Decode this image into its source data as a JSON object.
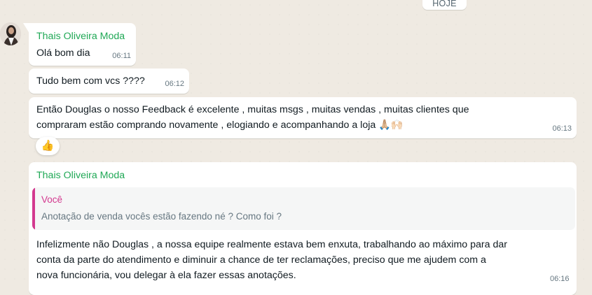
{
  "date_chip": "HOJE",
  "messages": [
    {
      "sender": "Thais Oliveira Moda",
      "text": "Olá bom dia",
      "time": "06:11"
    },
    {
      "text": "Tudo bem com vcs ????",
      "time": "06:12"
    },
    {
      "text_line1": "Então Douglas o nosso Feedback é excelente , muitas msgs , muitas vendas , muitas clientes que",
      "text_line2": "compraram estão comprando novamente , elogiando e acompanhando a loja 🙏🏼🙌🏻",
      "time": "06:13",
      "reaction": "👍"
    },
    {
      "sender": "Thais Oliveira Moda",
      "quote": {
        "author": "Você",
        "text": "Anotação de venda vocês estão fazendo né ? Como foi ?"
      },
      "line1": "Infelizmente não Douglas , a nossa equipe realmente estava bem enxuta, trabalhando ao máximo para dar",
      "line2": "conta da parte do atendimento e diminuir a chance de ter reclamações, preciso que me ajudem com a",
      "line3": "nova funcionária, vou delegar à ela fazer essas anotações.",
      "time": "06:16"
    }
  ],
  "colors": {
    "background": "#efeae2",
    "sender": "#1fa855",
    "quote_accent": "#d3398f",
    "bubble": "#ffffff"
  }
}
